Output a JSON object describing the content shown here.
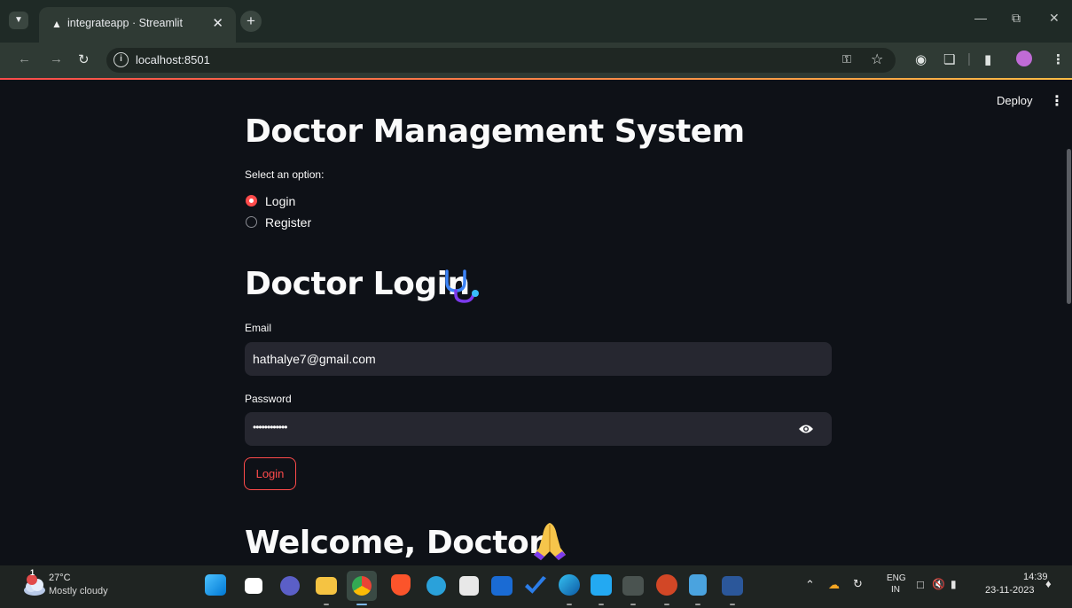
{
  "browser": {
    "tab_title": "integrateapp · Streamlit",
    "url": "localhost:8501"
  },
  "streamlit": {
    "deploy_label": "Deploy",
    "app_title": "Doctor Management System",
    "select_label": "Select an option:",
    "radio_options": [
      {
        "label": "Login",
        "selected": true
      },
      {
        "label": "Register",
        "selected": false
      }
    ],
    "login_heading": "Doctor Login",
    "email_label": "Email",
    "email_value": "hathalye7@gmail.com",
    "password_label": "Password",
    "password_value": "••••••••••••",
    "login_button": "Login",
    "welcome_heading": "Welcome, Doctor"
  },
  "taskbar": {
    "weather_badge": "1",
    "temperature": "27°C",
    "condition": "Mostly cloudy",
    "lang_top": "ENG",
    "lang_bottom": "IN",
    "time": "14:39",
    "date": "23-11-2023"
  },
  "colors": {
    "accent": "#ff4b4b",
    "background": "#0e1117",
    "input_bg": "#262730"
  }
}
